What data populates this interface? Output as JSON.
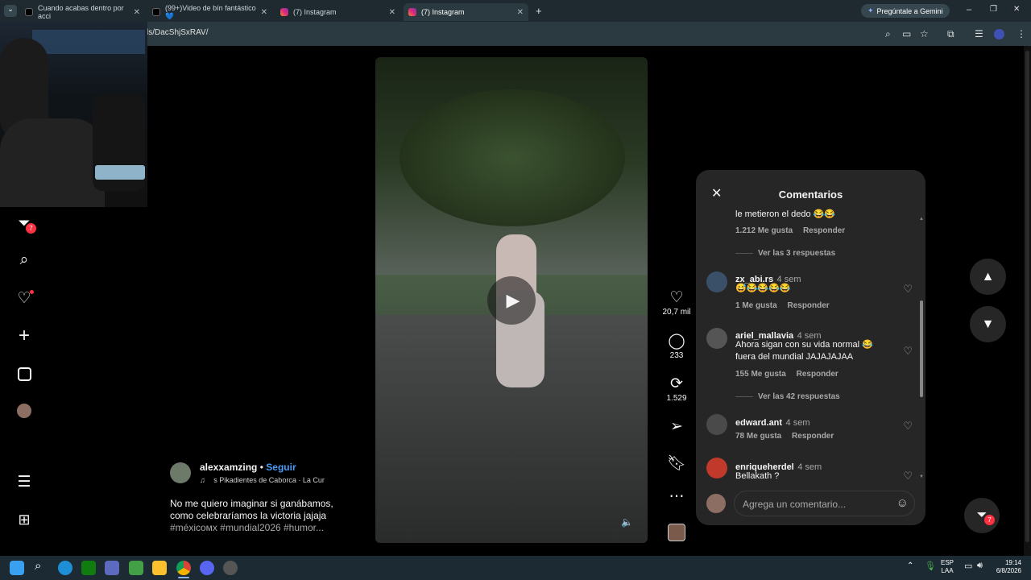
{
  "browser": {
    "tabs": [
      {
        "title": "Cuando acabas dentro por acci",
        "favicon_color": "#111111"
      },
      {
        "title": "(99+)Video de bín fantástico 💙",
        "favicon_color": "#111111"
      },
      {
        "title": "(7) Instagram",
        "favicon_color": "#e1306c"
      },
      {
        "title": "(7) Instagram",
        "favicon_color": "#e1306c"
      }
    ],
    "gemini_label": "Pregúntale a Gemini",
    "url": "ls/DacShjSxRAV/"
  },
  "sidebar": {
    "messages_badge": "7"
  },
  "post": {
    "username": "alexxamzing",
    "follow_label": "Seguir",
    "audio": "s Pikadientes de Caborca · La Cur",
    "caption_line1": "No me quiero imaginar si ganábamos,",
    "caption_line2": "como celebraríamos la victoria jajaja",
    "hashtags": "#méxicoмx #mundial2026 #humor..."
  },
  "actions": {
    "likes": "20,7 mil",
    "comments": "233",
    "reposts": "1.529"
  },
  "comments": {
    "title": "Comentarios",
    "partial_text": "le metieron el dedo 😂😂",
    "partial_likes": "1.212 Me gusta",
    "reply_label": "Responder",
    "view_replies_1": "Ver las 3 respuestas",
    "items": [
      {
        "user": "zx_abi.rs",
        "time": "4 sem",
        "text": "😅😂😂😂😂",
        "likes": "1 Me gusta",
        "avatar_color": "#3a5068"
      },
      {
        "user": "ariel_mallavia",
        "time": "4 sem",
        "text": "Ahora sigan con su vida normal 😂 fuera del mundial JAJAJAJAA",
        "likes": "155 Me gusta",
        "avatar_color": "#555555"
      },
      {
        "user": "edward.ant",
        "time": "4 sem",
        "text": "",
        "likes": "78 Me gusta",
        "avatar_color": "#4a4a4a"
      },
      {
        "user": "enriqueherdel",
        "time": "4 sem",
        "text": "Bellakath ?",
        "likes": "",
        "avatar_color": "#c0392b"
      }
    ],
    "view_replies_2": "Ver las 42 respuestas",
    "input_placeholder": "Agrega un comentario..."
  },
  "right_badge": "7",
  "taskbar": {
    "lang_line1": "ESP",
    "lang_line2": "LAA",
    "time": "19:14",
    "date": "6/8/2026"
  }
}
